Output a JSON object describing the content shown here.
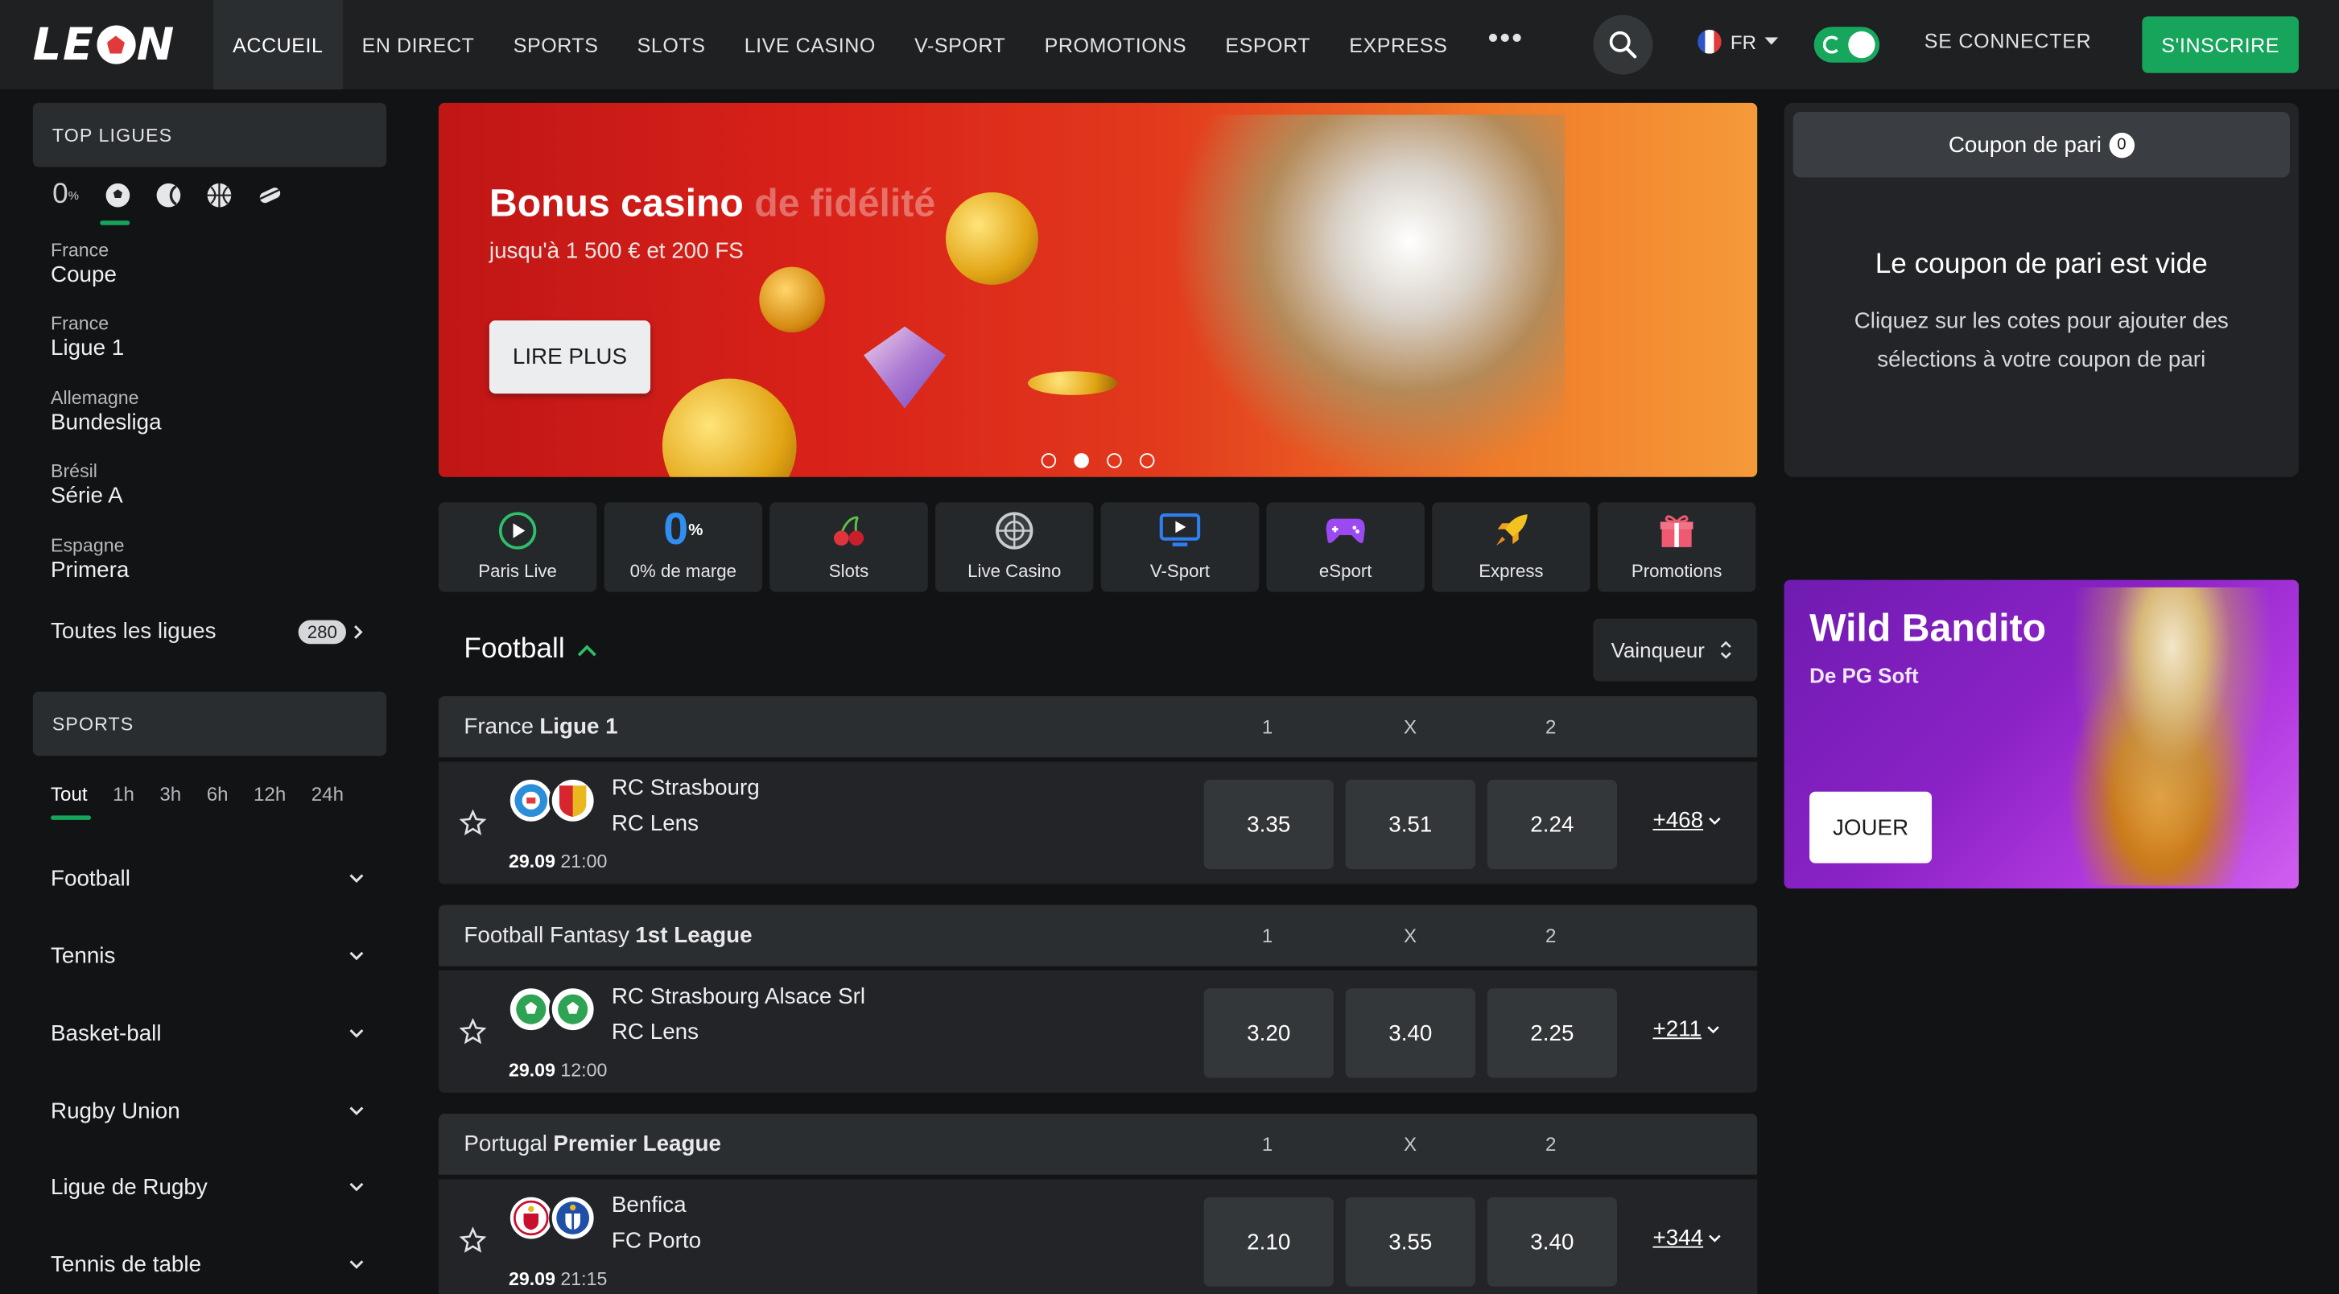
{
  "header": {
    "logo_text": "LEON",
    "nav": [
      "ACCUEIL",
      "EN DIRECT",
      "SPORTS",
      "SLOTS",
      "LIVE CASINO",
      "V-SPORT",
      "PROMOTIONS",
      "ESPORT",
      "EXPRESS"
    ],
    "nav_more": "•••",
    "lang": "FR",
    "login": "SE CONNECTER",
    "signup": "S'INSCRIRE"
  },
  "sidebar": {
    "top_title": "TOP LIGUES",
    "zero_margin_icon": "0%",
    "leagues": [
      {
        "country": "France",
        "name": "Coupe"
      },
      {
        "country": "France",
        "name": "Ligue 1"
      },
      {
        "country": "Allemagne",
        "name": "Bundesliga"
      },
      {
        "country": "Brésil",
        "name": "Série A"
      },
      {
        "country": "Espagne",
        "name": "Primera"
      }
    ],
    "all_leagues": "Toutes les ligues",
    "all_leagues_count": "280",
    "sports_title": "SPORTS",
    "time_filters": [
      "Tout",
      "1h",
      "3h",
      "6h",
      "12h",
      "24h"
    ],
    "sports": [
      "Football",
      "Tennis",
      "Basket-ball",
      "Rugby Union",
      "Ligue de Rugby",
      "Tennis de table"
    ]
  },
  "banner": {
    "title": "Bonus casino",
    "title_faded": "de fidélité",
    "subtitle": "jusqu'à 1 500 € et 200 FS",
    "button": "LIRE PLUS",
    "active_slide": 2,
    "slides": 4
  },
  "quick_links": [
    {
      "label": "Paris Live",
      "icon": "play-circle-icon"
    },
    {
      "label": "0% de marge",
      "icon": "zero-percent-icon"
    },
    {
      "label": "Slots",
      "icon": "cherries-icon"
    },
    {
      "label": "Live Casino",
      "icon": "roulette-icon"
    },
    {
      "label": "V-Sport",
      "icon": "monitor-play-icon"
    },
    {
      "label": "eSport",
      "icon": "gamepad-icon"
    },
    {
      "label": "Express",
      "icon": "rocket-icon"
    },
    {
      "label": "Promotions",
      "icon": "gift-icon"
    }
  ],
  "main": {
    "section_title": "Football",
    "market_selector": "Vainqueur",
    "col_labels": [
      "1",
      "X",
      "2"
    ],
    "leagues": [
      {
        "prefix": "France",
        "name": "Ligue 1",
        "match": {
          "home": "RC Strasbourg",
          "away": "RC Lens",
          "date": "29.09",
          "time": "21:00",
          "odds": [
            "3.35",
            "3.51",
            "2.24"
          ],
          "more": "+468"
        }
      },
      {
        "prefix": "Football Fantasy",
        "name": "1st League",
        "match": {
          "home": "RC Strasbourg Alsace Srl",
          "away": "RC Lens",
          "date": "29.09",
          "time": "12:00",
          "odds": [
            "3.20",
            "3.40",
            "2.25"
          ],
          "more": "+211"
        }
      },
      {
        "prefix": "Portugal",
        "name": "Premier League",
        "match": {
          "home": "Benfica",
          "away": "FC Porto",
          "date": "29.09",
          "time": "21:15",
          "odds": [
            "2.10",
            "3.55",
            "3.40"
          ],
          "more": "+344"
        }
      }
    ]
  },
  "coupon": {
    "tab_label": "Coupon de pari",
    "count": "0",
    "empty_title": "Le coupon de pari est vide",
    "empty_hint": "Cliquez sur les cotes pour ajouter des sélections à votre coupon de pari"
  },
  "promo": {
    "title": "Wild Bandito",
    "subtitle": "De PG Soft",
    "button": "JOUER"
  },
  "colors": {
    "accent": "#17a45b",
    "background": "#121314",
    "panel": "#222427"
  }
}
